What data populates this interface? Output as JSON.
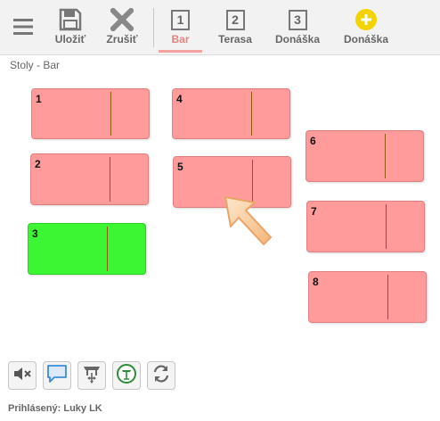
{
  "toolbar": {
    "menu_icon": "hamburger-menu-icon",
    "save": {
      "label": "Uložiť",
      "icon": "floppy-disk-icon"
    },
    "cancel": {
      "label": "Zrušiť",
      "icon": "x-cross-icon"
    },
    "tabs": [
      {
        "number": "1",
        "label": "Bar",
        "active": true
      },
      {
        "number": "2",
        "label": "Terasa",
        "active": false
      },
      {
        "number": "3",
        "label": "Donáška",
        "active": false
      }
    ],
    "add_delivery": {
      "label": "Donáška",
      "icon": "plus-circle-icon"
    }
  },
  "page_title": "Stoly - Bar",
  "tables": [
    {
      "number": "1",
      "status": "occupied"
    },
    {
      "number": "2",
      "status": "occupied"
    },
    {
      "number": "3",
      "status": "free"
    },
    {
      "number": "4",
      "status": "occupied"
    },
    {
      "number": "5",
      "status": "occupied"
    },
    {
      "number": "6",
      "status": "occupied"
    },
    {
      "number": "7",
      "status": "occupied"
    },
    {
      "number": "8",
      "status": "occupied"
    }
  ],
  "bottom_buttons": [
    {
      "icon": "speaker-mute-icon"
    },
    {
      "icon": "speech-bubble-icon"
    },
    {
      "icon": "table-move-icon"
    },
    {
      "icon": "table-info-icon"
    },
    {
      "icon": "refresh-icon"
    }
  ],
  "footer": {
    "logged_in": "Prihlásený: Luky LK"
  },
  "colors": {
    "occupied": "#ff9b9b",
    "free": "#3cf533",
    "active_tab": "#e8837f",
    "accent_yellow": "#f3d400"
  }
}
